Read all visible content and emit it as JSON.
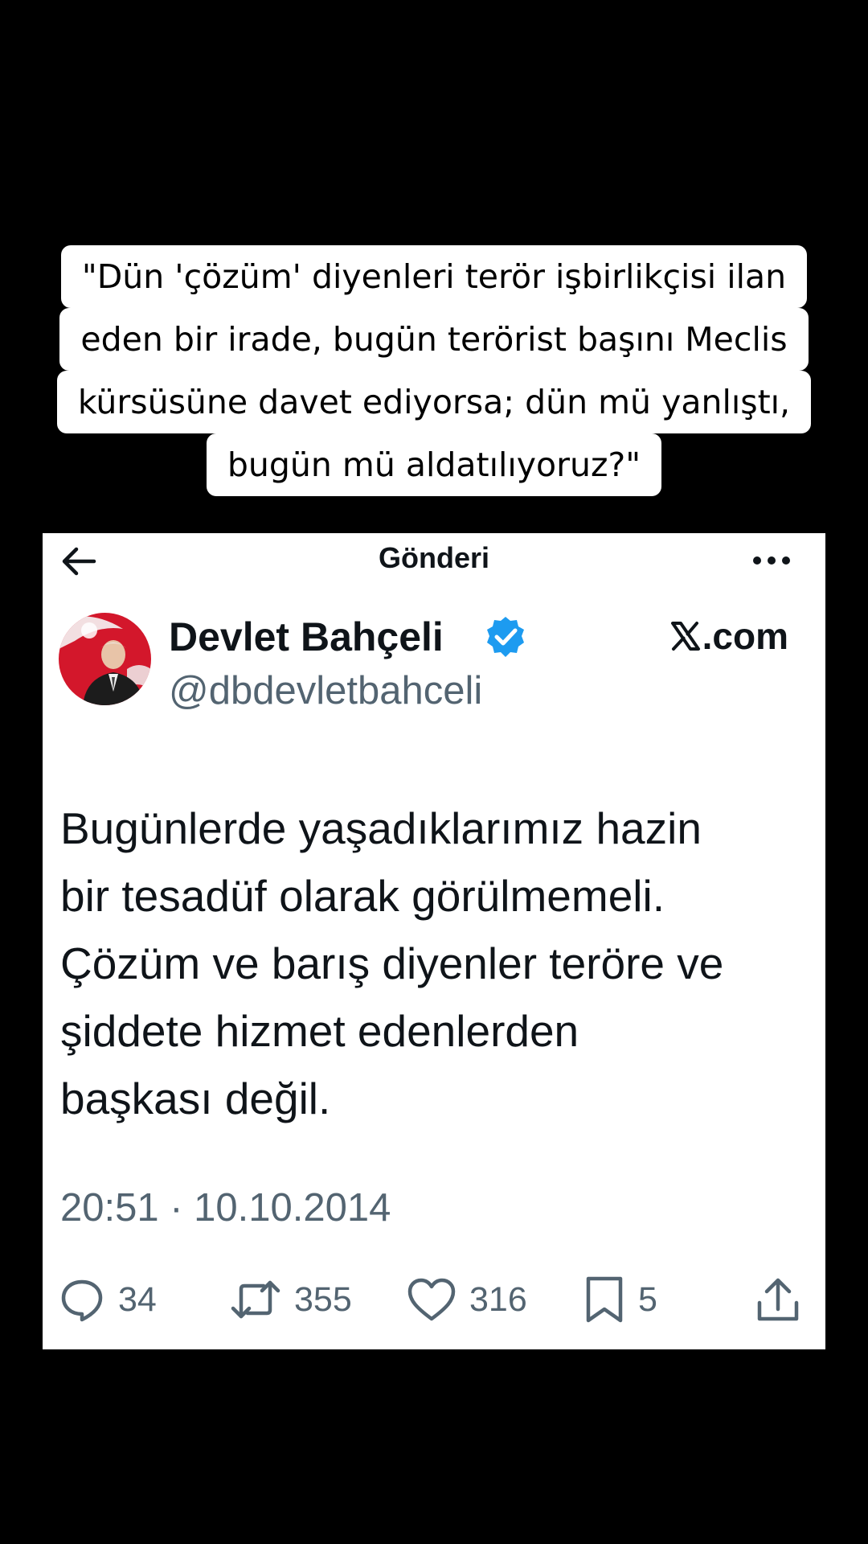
{
  "caption": {
    "lines": [
      "\"Dün 'çözüm' diyenleri terör işbirlikçisi ilan",
      "eden bir irade, bugün terörist başını Meclis",
      "kürsüsüne davet ediyorsa; dün mü yanlıştı,",
      "bugün mü aldatılıyoruz?\""
    ]
  },
  "topbar": {
    "title": "Gönderi",
    "back_icon": "arrow-left-icon",
    "more_icon": "more-horizontal-icon"
  },
  "tweet": {
    "author_name": "Devlet Bahçeli",
    "handle": "@dbdevletbahceli",
    "verified_icon": "verified-badge-icon",
    "brand_label": ".com",
    "brand_icon": "x-logo-icon",
    "text": "Bugünlerde yaşadıklarımız hazin\nbir tesadüf olarak görülmemeli.\nÇözüm ve barış diyenler teröre ve\nşiddete hizmet edenlerden\nbaşkası değil.",
    "timestamp": "20:51 · 10.10.2014"
  },
  "actions": {
    "reply_count": "34",
    "repost_count": "355",
    "like_count": "316",
    "bookmark_count": "5"
  },
  "colors": {
    "background": "#000000",
    "card": "#ffffff",
    "text_primary": "#0f1419",
    "text_secondary": "#536471",
    "verified_blue": "#1d9bf0",
    "avatar_red": "#d3172b"
  }
}
